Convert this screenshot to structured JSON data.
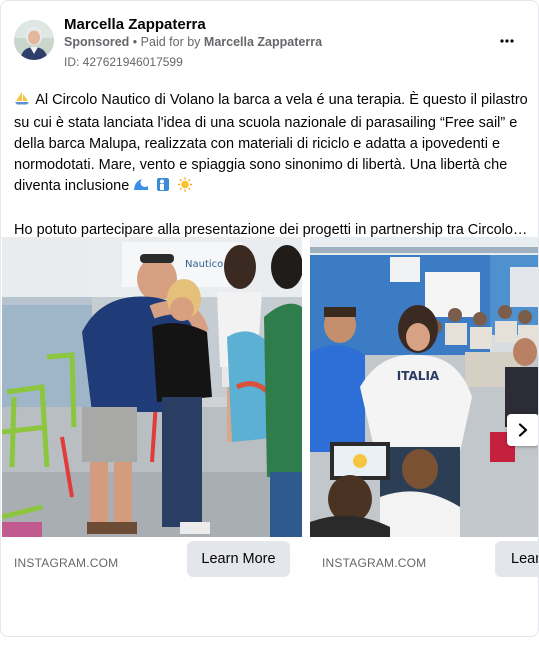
{
  "ad": {
    "page_name": "Marcella Zappaterra",
    "sponsored_label": "Sponsored",
    "separator": "•",
    "paid_for_prefix": "Paid for by",
    "paid_for_name": "Marcella Zappaterra",
    "ad_id": "ID: 427621946017599",
    "more_icon": "more-horizontal-icon"
  },
  "body": {
    "paragraph_1": "Al Circolo Nautico di Volano la barca a vela é una terapia. È questo il pilastro su cui è stata lanciata l'idea di una scuola nazionale di parasailing “Free sail” e della barca Malupa, realizzata con materiali di riciclo e adatta a ipovedenti e normodotati. Mare, vento e spiaggia sono sinonimo di libertà. Una libertà che diventa inclusione",
    "paragraph_2": "Ho potuto partecipare alla presentazione dei progetti in partnership tra Circolo…",
    "leading_emoji": "sailboat-emoji",
    "trailing_emojis": [
      "wave-emoji",
      "person-deaf-emoji",
      "sun-emoji"
    ]
  },
  "carousel": {
    "cards": [
      {
        "domain": "INSTAGRAM.COM",
        "cta": "Learn More",
        "image": "people-embracing-photo",
        "sign_text": "Nautico"
      },
      {
        "domain": "INSTAGRAM.COM",
        "cta": "Lear",
        "image": "italia-team-presentation-photo",
        "shirt_text": "ITALIA"
      }
    ],
    "next_icon": "chevron-right-icon"
  },
  "colors": {
    "secondary_text": "#65676b",
    "button_bg": "#e4e6eb",
    "border": "#e4e6eb"
  }
}
